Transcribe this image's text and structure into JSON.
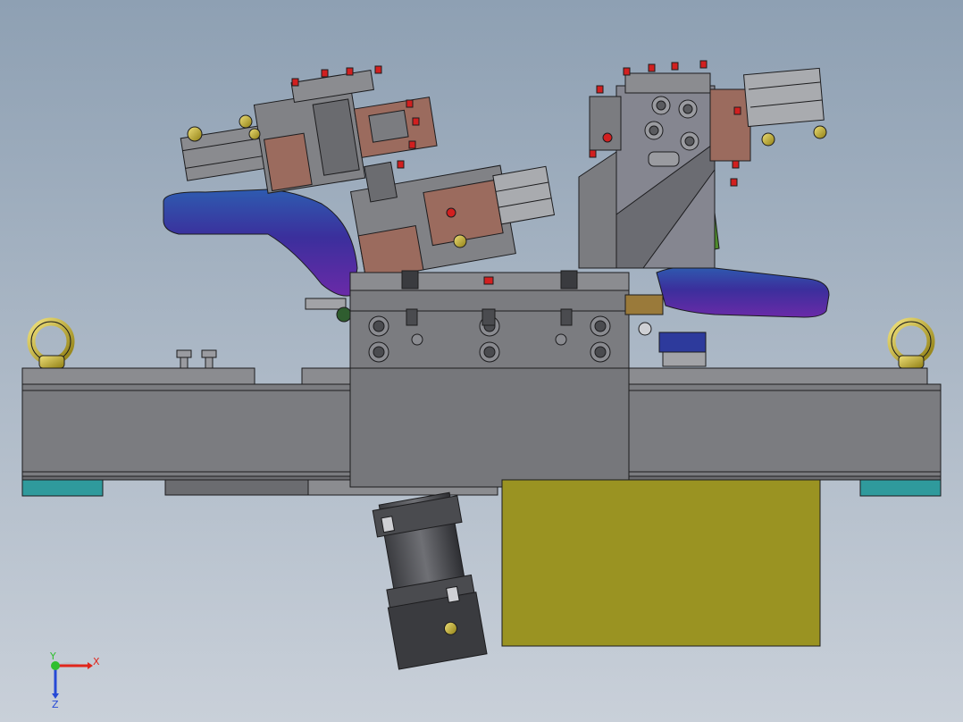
{
  "scene": {
    "background_top": "#8ea0b3",
    "background_bottom": "#c4ccd6",
    "colors": {
      "steel": "#7b7c80",
      "steel_dark": "#4a4b4f",
      "steel_light": "#a2a3a7",
      "edge": "#1c1c1e",
      "copper": "#9b6b5e",
      "purple_part": "#5b2a9c",
      "blue_part": "#27579c",
      "olive_block": "#9a9322",
      "teal_pad": "#2f9a9c",
      "gold": "#c9b225",
      "red_fitting": "#d21f1f",
      "green_fitting": "#4e8a2c"
    }
  },
  "triad": {
    "x_label": "X",
    "y_label": "Y",
    "z_label": "Z",
    "x_color": "#e0261c",
    "y_color": "#2fbf2f",
    "z_color": "#2649d6"
  }
}
